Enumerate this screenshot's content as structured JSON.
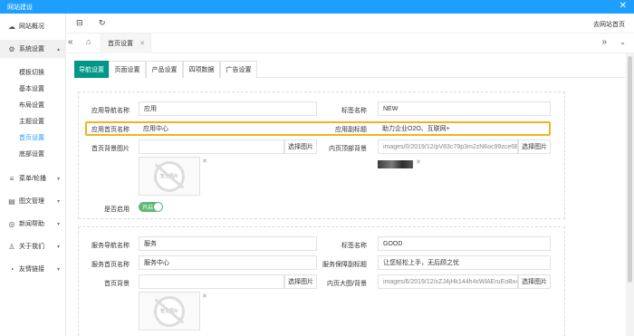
{
  "window": {
    "title": "网站建设",
    "close_glyph": "✕"
  },
  "header": {
    "home_link": "去网站首页"
  },
  "sidebar": {
    "items": [
      {
        "label": "网站概况",
        "icon": "dashboard-icon"
      },
      {
        "label": "系统设置",
        "icon": "gear-icon"
      },
      {
        "label": "菜单/轮播",
        "icon": "menu-icon"
      },
      {
        "label": "图文管理",
        "icon": "document-icon"
      },
      {
        "label": "新闻帮助",
        "icon": "chat-icon"
      },
      {
        "label": "关于我们",
        "icon": "user-icon"
      },
      {
        "label": "友情链接",
        "icon": "link-icon"
      }
    ],
    "subitems": [
      "模板切换",
      "基本设置",
      "布局设置",
      "主题设置",
      "首页设置",
      "底部设置"
    ],
    "active_sub": "首页设置"
  },
  "tabbar": {
    "current_tab": "首页设置"
  },
  "subtabs": [
    "导航设置",
    "页面设置",
    "产品设置",
    "四项数据",
    "广告设置"
  ],
  "section1": {
    "nav_label": "应用导航名称",
    "nav_value": "应用",
    "tag_label": "标签名称",
    "tag_value": "NEW",
    "home_label": "应用首页名称",
    "home_value": "应用中心",
    "subtitle_label": "应用副标题",
    "subtitle_value": "助力企业O2O、互联网+",
    "bg_label": "首页背景图片",
    "bg_value": "",
    "inner_bg_label": "内页顶部背景",
    "inner_bg_value": "images/0/2019/12/pV83c79p3m2zN6oc99zce6Baz",
    "select_btn": "选择图片",
    "no_image": "暂无图片",
    "enable_label": "是否启用",
    "enable_value": "开启"
  },
  "section2": {
    "nav_label": "服务导航名称",
    "nav_value": "服务",
    "tag_label": "标签名称",
    "tag_value": "GOOD",
    "home_label": "服务首页名称",
    "home_value": "服务中心",
    "subtitle_label": "服务保障副标题",
    "subtitle_value": "让您轻松上手，无后顾之忧",
    "bg_label": "首页背景",
    "bg_value": "",
    "inner_bg_label": "内页大图/背景",
    "inner_bg_value": "images/6/2019/12/xZJ4jHk144h4xWlAEruEoBx4f",
    "select_btn": "选择图片",
    "no_image": "暂无图片"
  },
  "colors": {
    "accent": "#1e9fff",
    "active_tab": "#009688",
    "toggle_on": "#5fb878",
    "highlight": "#f0b323"
  }
}
